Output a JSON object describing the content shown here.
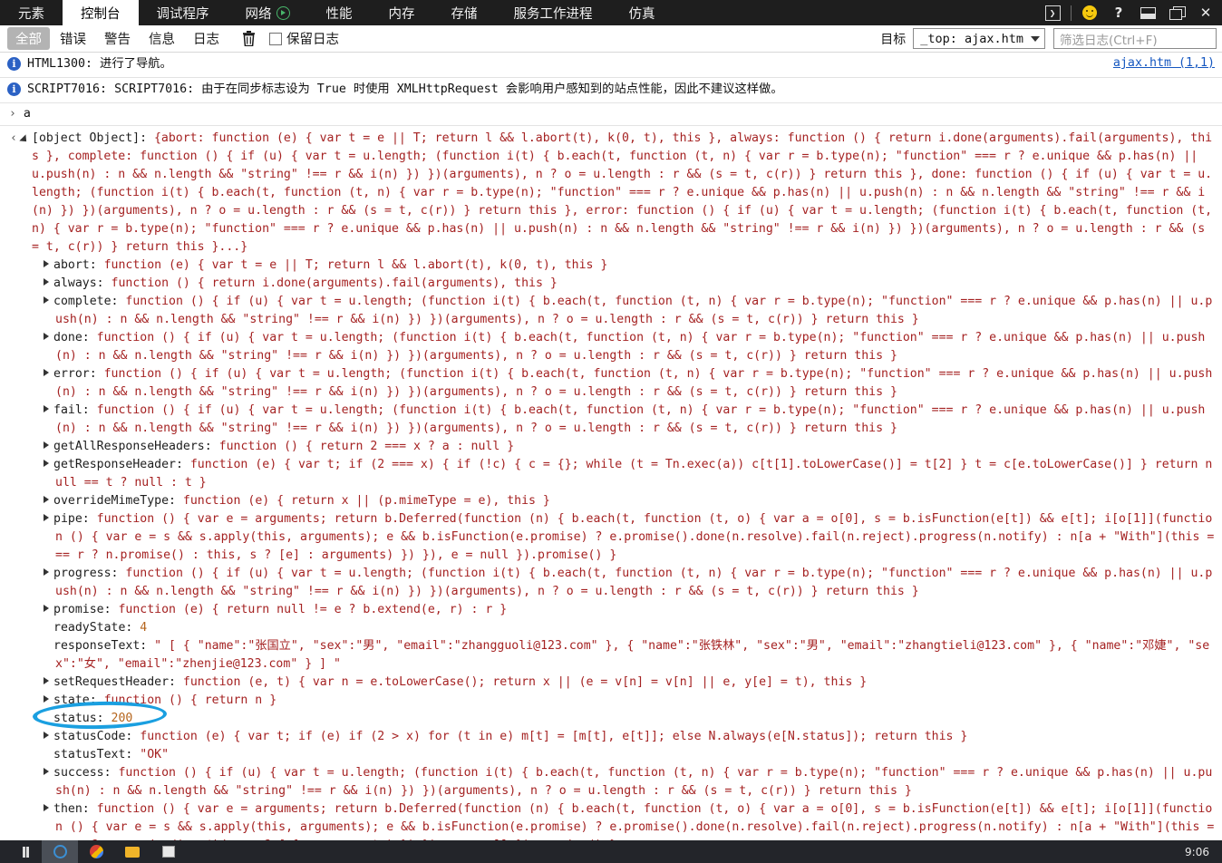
{
  "window": {
    "tabs": [
      {
        "label": "元素",
        "icon": null,
        "active": false
      },
      {
        "label": "控制台",
        "icon": null,
        "active": true
      },
      {
        "label": "调试程序",
        "icon": null,
        "active": false
      },
      {
        "label": "网络",
        "icon": "play-icon",
        "active": false
      },
      {
        "label": "性能",
        "icon": null,
        "active": false
      },
      {
        "label": "内存",
        "icon": null,
        "active": false
      },
      {
        "label": "存储",
        "icon": null,
        "active": false
      },
      {
        "label": "服务工作进程",
        "icon": null,
        "active": false
      },
      {
        "label": "仿真",
        "icon": null,
        "active": false
      }
    ],
    "right_icons": [
      {
        "name": "console-drawer-icon",
        "glyph": "❯"
      },
      {
        "name": "feedback-smiley-icon",
        "glyph": ""
      },
      {
        "name": "help-icon",
        "glyph": "?"
      },
      {
        "name": "dock-icon",
        "glyph": ""
      },
      {
        "name": "restore-icon",
        "glyph": ""
      },
      {
        "name": "close-icon",
        "glyph": "✕"
      }
    ]
  },
  "toolbar": {
    "filters": [
      {
        "label": "全部",
        "selected": true
      },
      {
        "label": "错误",
        "selected": false
      },
      {
        "label": "警告",
        "selected": false
      },
      {
        "label": "信息",
        "selected": false
      },
      {
        "label": "日志",
        "selected": false
      }
    ],
    "clear_icon": "trash-icon",
    "preserve_log_label": "保留日志",
    "preserve_log_checked": false,
    "target_label": "目标",
    "target_value": "_top: ajax.htm",
    "filter_placeholder": "筛选日志(Ctrl+F)"
  },
  "messages": [
    {
      "level": "info",
      "text": "HTML1300: 进行了导航。",
      "link": "ajax.htm (1,1)"
    },
    {
      "level": "info",
      "text": "SCRIPT7016: SCRIPT7016: 由于在同步标志设为 True 时使用 XMLHttpRequest 会影响用户感知到的站点性能，因此不建议这样做。",
      "link": ""
    }
  ],
  "prompt": {
    "chevron": "›",
    "input_value": "a"
  },
  "result": {
    "header_label": "[object Object]: ",
    "header_value": "{abort: function (e) { var t = e || T; return l && l.abort(t), k(0, t), this }, always: function () { return i.done(arguments).fail(arguments), this }, complete: function () { if (u) { var t = u.length; (function i(t) { b.each(t, function (t, n) { var r = b.type(n); \"function\" === r ? e.unique && p.has(n) || u.push(n) : n && n.length && \"string\" !== r && i(n) }) })(arguments), n ? o = u.length : r && (s = t, c(r)) } return this }, done: function () { if (u) { var t = u.length; (function i(t) { b.each(t, function (t, n) { var r = b.type(n); \"function\" === r ? e.unique && p.has(n) || u.push(n) : n && n.length && \"string\" !== r && i(n) }) })(arguments), n ? o = u.length : r && (s = t, c(r)) } return this }, error: function () { if (u) { var t = u.length; (function i(t) { b.each(t, function (t, n) { var r = b.type(n); \"function\" === r ? e.unique && p.has(n) || u.push(n) : n && n.length && \"string\" !== r && i(n) }) })(arguments), n ? o = u.length : r && (s = t, c(r)) } return this }...}",
    "properties": [
      {
        "expandable": true,
        "key": "abort: ",
        "value": "function (e) { var t = e || T; return l && l.abort(t), k(0, t), this }"
      },
      {
        "expandable": true,
        "key": "always: ",
        "value": "function () { return i.done(arguments).fail(arguments), this }"
      },
      {
        "expandable": true,
        "key": "complete: ",
        "value": "function () { if (u) { var t = u.length; (function i(t) { b.each(t, function (t, n) { var r = b.type(n); \"function\" === r ? e.unique && p.has(n) || u.push(n) : n && n.length && \"string\" !== r && i(n) }) })(arguments), n ? o = u.length : r && (s = t, c(r)) } return this }"
      },
      {
        "expandable": true,
        "key": "done: ",
        "value": "function () { if (u) { var t = u.length; (function i(t) { b.each(t, function (t, n) { var r = b.type(n); \"function\" === r ? e.unique && p.has(n) || u.push(n) : n && n.length && \"string\" !== r && i(n) }) })(arguments), n ? o = u.length : r && (s = t, c(r)) } return this }"
      },
      {
        "expandable": true,
        "key": "error: ",
        "value": "function () { if (u) { var t = u.length; (function i(t) { b.each(t, function (t, n) { var r = b.type(n); \"function\" === r ? e.unique && p.has(n) || u.push(n) : n && n.length && \"string\" !== r && i(n) }) })(arguments), n ? o = u.length : r && (s = t, c(r)) } return this }"
      },
      {
        "expandable": true,
        "key": "fail: ",
        "value": "function () { if (u) { var t = u.length; (function i(t) { b.each(t, function (t, n) { var r = b.type(n); \"function\" === r ? e.unique && p.has(n) || u.push(n) : n && n.length && \"string\" !== r && i(n) }) })(arguments), n ? o = u.length : r && (s = t, c(r)) } return this }"
      },
      {
        "expandable": true,
        "key": "getAllResponseHeaders: ",
        "value": "function () { return 2 === x ? a : null }"
      },
      {
        "expandable": true,
        "key": "getResponseHeader: ",
        "value": "function (e) { var t; if (2 === x) { if (!c) { c = {}; while (t = Tn.exec(a)) c[t[1].toLowerCase()] = t[2] } t = c[e.toLowerCase()] } return null == t ? null : t }"
      },
      {
        "expandable": true,
        "key": "overrideMimeType: ",
        "value": "function (e) { return x || (p.mimeType = e), this }"
      },
      {
        "expandable": true,
        "key": "pipe: ",
        "value": "function () { var e = arguments; return b.Deferred(function (n) { b.each(t, function (t, o) { var a = o[0], s = b.isFunction(e[t]) && e[t]; i[o[1]](function () { var e = s && s.apply(this, arguments); e && b.isFunction(e.promise) ? e.promise().done(n.resolve).fail(n.reject).progress(n.notify) : n[a + \"With\"](this === r ? n.promise() : this, s ? [e] : arguments) }) }), e = null }).promise() }"
      },
      {
        "expandable": true,
        "key": "progress: ",
        "value": "function () { if (u) { var t = u.length; (function i(t) { b.each(t, function (t, n) { var r = b.type(n); \"function\" === r ? e.unique && p.has(n) || u.push(n) : n && n.length && \"string\" !== r && i(n) }) })(arguments), n ? o = u.length : r && (s = t, c(r)) } return this }"
      },
      {
        "expandable": true,
        "key": "promise: ",
        "value": "function (e) { return null != e ? b.extend(e, r) : r }"
      },
      {
        "expandable": false,
        "key": "readyState: ",
        "value": "4",
        "value_kind": "number"
      },
      {
        "expandable": false,
        "key": "responseText: ",
        "value": "\" [ { \"name\":\"张国立\", \"sex\":\"男\", \"email\":\"zhangguoli@123.com\" }, { \"name\":\"张铁林\", \"sex\":\"男\", \"email\":\"zhangtieli@123.com\" }, { \"name\":\"邓婕\", \"sex\":\"女\", \"email\":\"zhenjie@123.com\" } ] \"",
        "annotated": true
      },
      {
        "expandable": true,
        "key": "setRequestHeader: ",
        "value": "function (e, t) { var n = e.toLowerCase(); return x || (e = v[n] = v[n] || e, y[e] = t), this }"
      },
      {
        "expandable": true,
        "key": "state: ",
        "value": "function () { return n }"
      },
      {
        "expandable": false,
        "key": "status: ",
        "value": "200",
        "value_kind": "number"
      },
      {
        "expandable": true,
        "key": "statusCode: ",
        "value": "function (e) { var t; if (e) if (2 > x) for (t in e) m[t] = [m[t], e[t]]; else N.always(e[N.status]); return this }"
      },
      {
        "expandable": false,
        "key": "statusText: ",
        "value": "\"OK\""
      },
      {
        "expandable": true,
        "key": "success: ",
        "value": "function () { if (u) { var t = u.length; (function i(t) { b.each(t, function (t, n) { var r = b.type(n); \"function\" === r ? e.unique && p.has(n) || u.push(n) : n && n.length && \"string\" !== r && i(n) }) })(arguments), n ? o = u.length : r && (s = t, c(r)) } return this }"
      },
      {
        "expandable": true,
        "key": "then: ",
        "value": "function () { var e = arguments; return b.Deferred(function (n) { b.each(t, function (t, o) { var a = o[0], s = b.isFunction(e[t]) && e[t]; i[o[1]](function () { var e = s && s.apply(this, arguments); e && b.isFunction(e.promise) ? e.promise().done(n.resolve).fail(n.reject).progress(n.notify) : n[a + \"With\"](this === r ? n.promise() : this, s ? [e] : arguments) }) }), e = null }).promise() }"
      }
    ]
  },
  "taskbar": {
    "clock": "9:06",
    "items": [
      "bars-icon",
      "ie-icon",
      "chrome-icon",
      "folder-icon",
      "notepad-icon"
    ]
  },
  "colors": {
    "tabbar_bg": "#1e1e1e",
    "code_value": "#a52222",
    "code_key": "#1d1d1d",
    "link": "#1557c0",
    "info_badge": "#2b61c4",
    "annotation": "#1a9fe0",
    "filter_selected_bg": "#b3b3b3"
  }
}
